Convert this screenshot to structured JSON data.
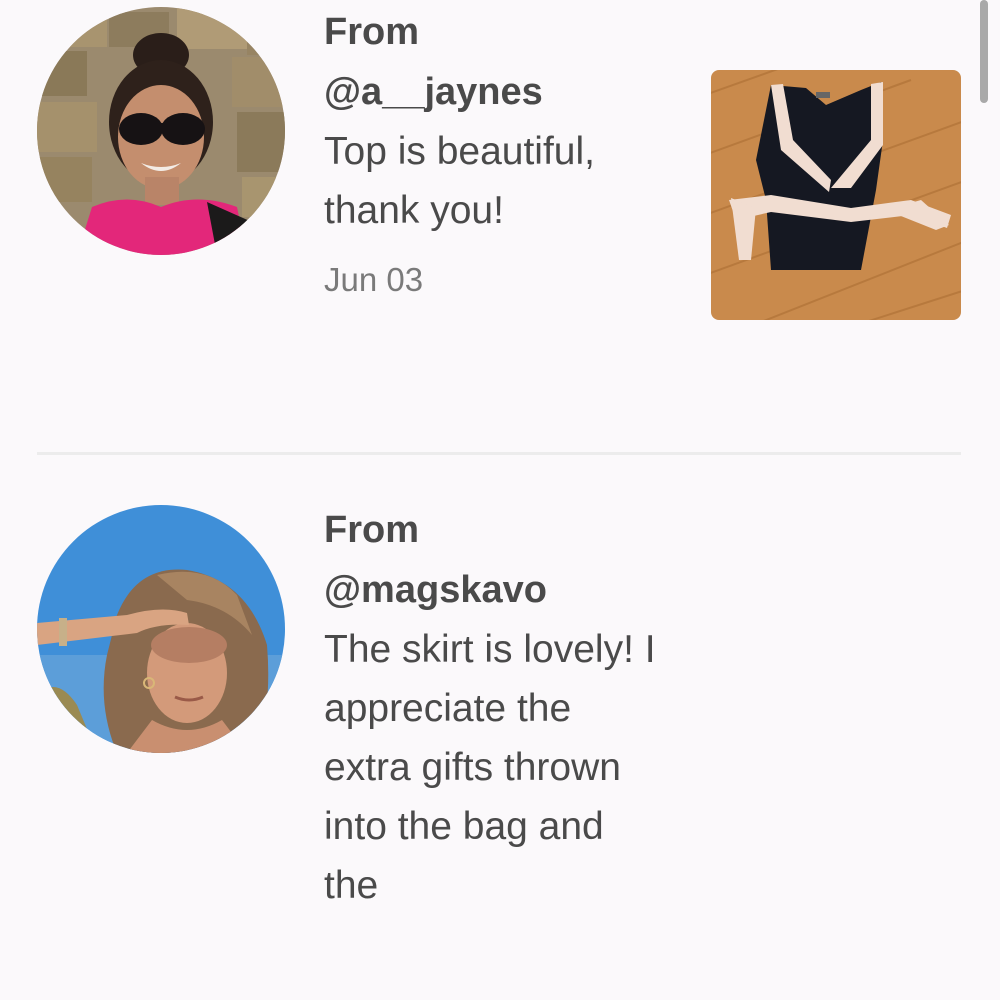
{
  "reviews": [
    {
      "from_label": "From",
      "handle": "@a__jaynes",
      "message": "Top is beautiful, thank you!",
      "date": "Jun 03",
      "avatar_icon": "profile-photo-woman-sunglasses",
      "thumbnail_icon": "product-photo-wrap-top"
    },
    {
      "from_label": "From",
      "handle": "@magskavo",
      "message": "The skirt is lovely! I appreciate the extra gifts thrown into the bag and the",
      "avatar_icon": "profile-photo-woman-shading-eyes"
    }
  ],
  "colors": {
    "background": "#fbf9fb",
    "text": "#4a4a4a",
    "date_text": "#7a7a7a",
    "divider": "#ececec",
    "scrollbar": "#a9a9a9"
  }
}
